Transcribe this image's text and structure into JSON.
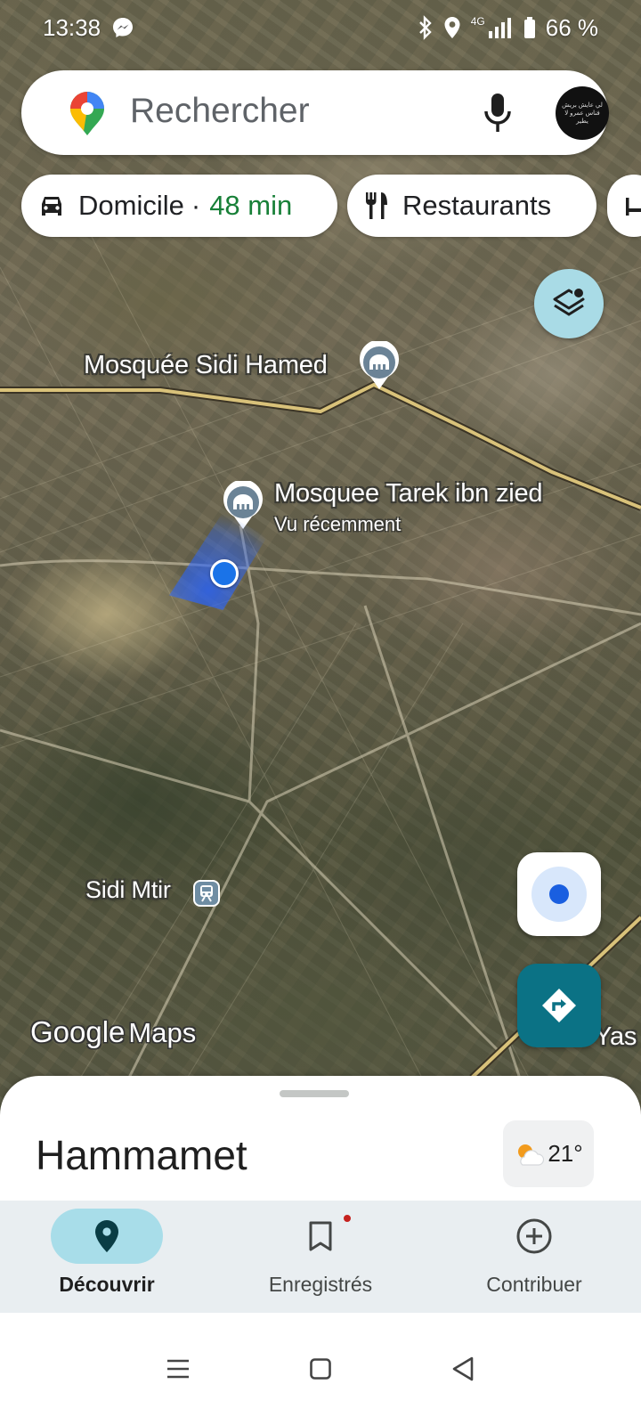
{
  "status_bar": {
    "time": "13:38",
    "network": "4G",
    "battery": "66 %"
  },
  "search": {
    "placeholder": "Rechercher"
  },
  "avatar_text": "لي عايش بريش فناس عمرو لا يطير",
  "chips": {
    "home_label": "Domicile",
    "home_sep": "·",
    "home_eta": "48 min",
    "restaurants_label": "Restaurants"
  },
  "map": {
    "labels": {
      "mosque_sidi_hamed": "Mosquée Sidi Hamed",
      "mosque_tarek": "Mosquee Tarek ibn zied",
      "mosque_tarek_sub": "Vu récemment",
      "sidi_mtir": "Sidi Mtir",
      "edge_label": "Yas"
    },
    "logo_google": "Google",
    "logo_maps": "Maps"
  },
  "sheet": {
    "place_title": "Hammamet",
    "temperature": "21°"
  },
  "nav": {
    "discover": "Découvrir",
    "saved": "Enregistrés",
    "contribute": "Contribuer"
  },
  "colors": {
    "accent_green": "#188038",
    "nav_active": "#a8dde9",
    "directions_btn": "#0b7285",
    "location_blue": "#1a73e8"
  }
}
